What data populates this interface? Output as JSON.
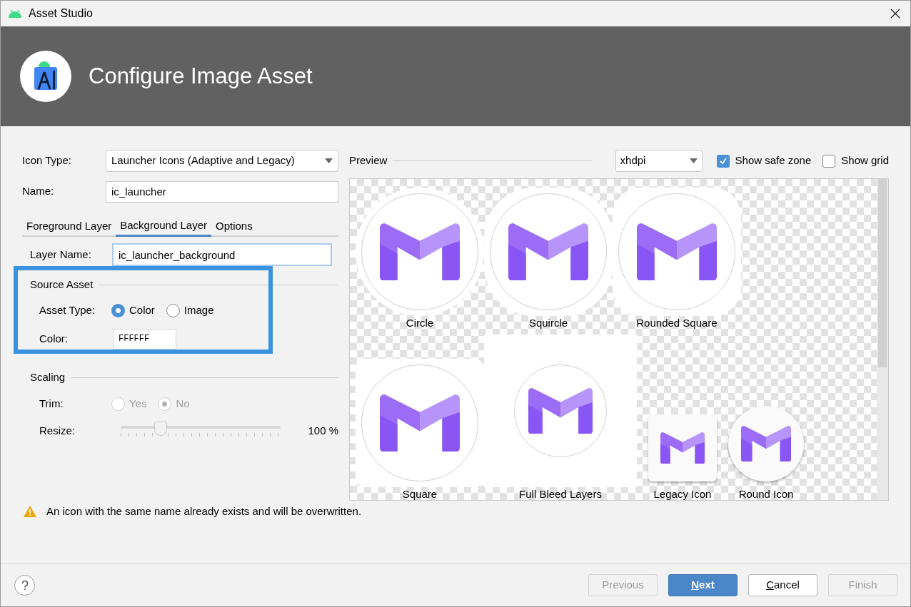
{
  "window": {
    "title": "Asset Studio"
  },
  "header": {
    "title": "Configure Image Asset"
  },
  "icon_type": {
    "label": "Icon Type:",
    "value": "Launcher Icons (Adaptive and Legacy)"
  },
  "name": {
    "label": "Name:",
    "value": "ic_launcher"
  },
  "tabs": [
    {
      "label": "Foreground Layer",
      "selected": false
    },
    {
      "label": "Background Layer",
      "selected": true
    },
    {
      "label": "Options",
      "selected": false
    }
  ],
  "layer_name": {
    "label": "Layer Name:",
    "value": "ic_launcher_background"
  },
  "source_asset": {
    "title": "Source Asset",
    "highlighted": true,
    "asset_type": {
      "label": "Asset Type:",
      "options": [
        {
          "label": "Color",
          "selected": true
        },
        {
          "label": "Image",
          "selected": false
        }
      ]
    },
    "color": {
      "label": "Color:",
      "value": "FFFFFF"
    }
  },
  "scaling": {
    "title": "Scaling",
    "disabled": true,
    "trim": {
      "label": "Trim:",
      "options": [
        {
          "label": "Yes",
          "selected": false
        },
        {
          "label": "No",
          "selected": true
        }
      ]
    },
    "resize": {
      "label": "Resize:",
      "level": 0.25,
      "reading": "100 %"
    }
  },
  "preview": {
    "title": "Preview",
    "density": "xhdpi",
    "show_safe_zone": {
      "label": "Show safe zone",
      "checked": true
    },
    "show_grid": {
      "label": "Show grid",
      "checked": false
    },
    "rows": [
      [
        {
          "label": "Circle",
          "kind": "circle"
        },
        {
          "label": "Squircle",
          "kind": "squircle"
        },
        {
          "label": "Rounded Square",
          "kind": "rounded"
        }
      ],
      [
        {
          "label": "Square",
          "kind": "square"
        },
        {
          "label": "Full Bleed Layers",
          "kind": "fullbleed"
        },
        {
          "label": "Legacy Icon",
          "kind": "legacy"
        },
        {
          "label": "Round Icon",
          "kind": "round"
        }
      ]
    ]
  },
  "warning": "An icon with the same name already exists and will be overwritten.",
  "buttons": [
    {
      "label": "Previous",
      "disabled": true,
      "primary": false,
      "mnemonic": false
    },
    {
      "label": "Next",
      "disabled": false,
      "primary": true,
      "mnemonic": true
    },
    {
      "label": "Cancel",
      "disabled": false,
      "primary": false,
      "mnemonic": true
    },
    {
      "label": "Finish",
      "disabled": true,
      "primary": false,
      "mnemonic": false
    }
  ]
}
